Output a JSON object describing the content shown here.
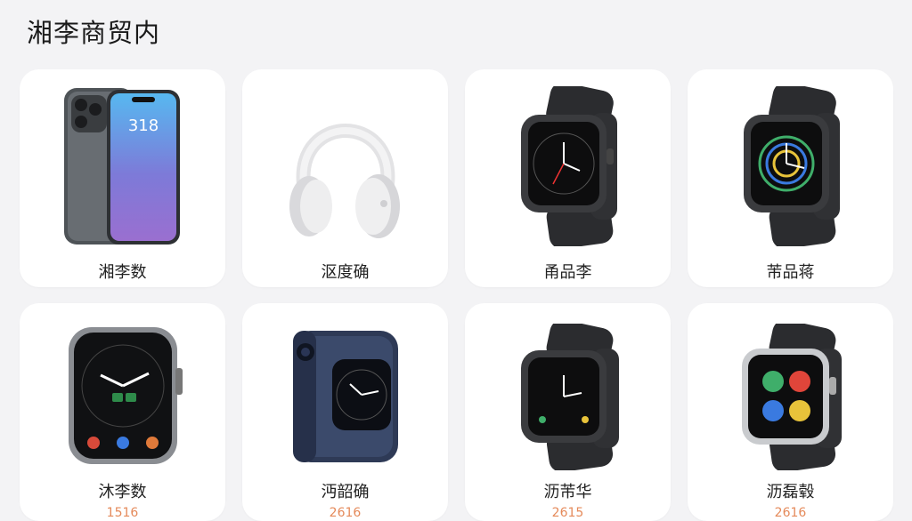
{
  "page": {
    "title": "湘李商贸内"
  },
  "products": [
    {
      "name": "湘李数",
      "image": "smartphone-icon"
    },
    {
      "name": "沤度确",
      "image": "headphones-icon"
    },
    {
      "name": "甬品李",
      "image": "smartwatch-icon"
    },
    {
      "name": "芾品蒋",
      "image": "smartwatch-icon"
    },
    {
      "name": "沐李数",
      "image": "smartwatch-icon",
      "price": "1516"
    },
    {
      "name": "沔韶确",
      "image": "flip-watch-icon",
      "price": "2616"
    },
    {
      "name": "沥芾华",
      "image": "smartwatch-icon",
      "price": "2615"
    },
    {
      "name": "沥磊毂",
      "image": "smartwatch-icon",
      "price": "2616"
    }
  ]
}
